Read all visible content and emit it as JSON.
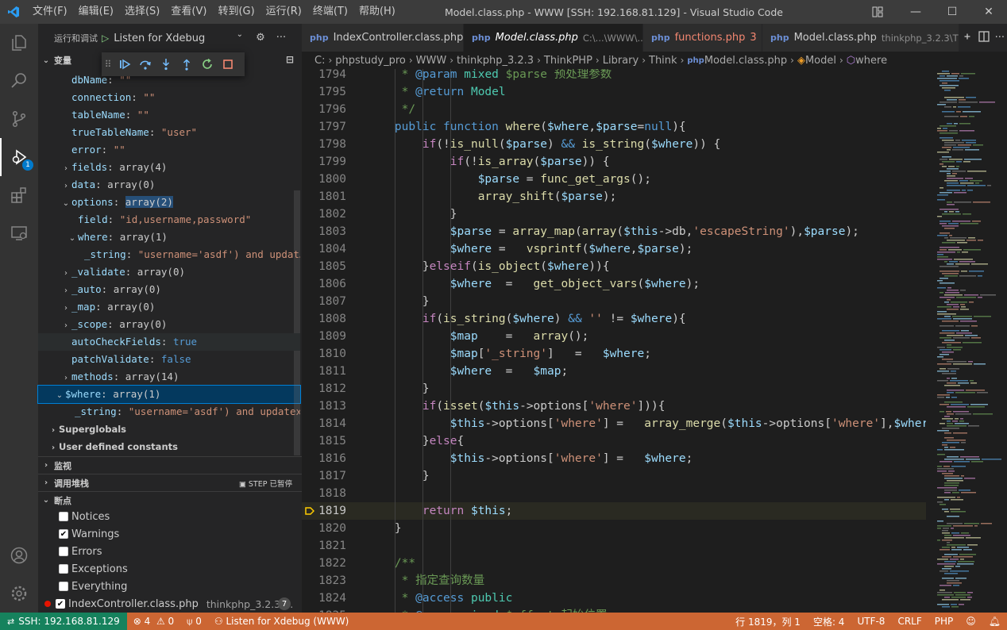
{
  "window": {
    "menu": [
      "文件(F)",
      "编辑(E)",
      "选择(S)",
      "查看(V)",
      "转到(G)",
      "运行(R)",
      "终端(T)",
      "帮助(H)"
    ],
    "title": "Model.class.php - WWW [SSH: 192.168.81.129] - Visual Studio Code"
  },
  "activity": {
    "debug_badge": "1"
  },
  "sidebar": {
    "run_label": "运行和调试",
    "config": "Listen for Xdebug",
    "variables_title": "变量",
    "variables": [
      {
        "indent": 0,
        "twisty": "",
        "key": "dbName",
        "val": "\"\"",
        "vtype": "s"
      },
      {
        "indent": 0,
        "twisty": "",
        "key": "connection",
        "val": "\"\"",
        "vtype": "s"
      },
      {
        "indent": 0,
        "twisty": "",
        "key": "tableName",
        "val": "\"\"",
        "vtype": "s"
      },
      {
        "indent": 0,
        "twisty": "",
        "key": "trueTableName",
        "val": "\"user\"",
        "vtype": "s"
      },
      {
        "indent": 0,
        "twisty": "",
        "key": "error",
        "val": "\"\"",
        "vtype": "s"
      },
      {
        "indent": 0,
        "twisty": "›",
        "key": "fields",
        "val": "array(4)",
        "vtype": "v"
      },
      {
        "indent": 0,
        "twisty": "›",
        "key": "data",
        "val": "array(0)",
        "vtype": "v"
      },
      {
        "indent": 0,
        "twisty": "⌄",
        "key": "options",
        "val": "array(2)",
        "vtype": "v"
      },
      {
        "indent": 1,
        "twisty": "",
        "key": "field",
        "val": "\"id,username,password\"",
        "vtype": "s"
      },
      {
        "indent": 1,
        "twisty": "⌄",
        "key": "where",
        "val": "array(1)",
        "vtype": "v"
      },
      {
        "indent": 2,
        "twisty": "",
        "key": "_string",
        "val": "\"username='asdf') and updat…",
        "vtype": "s"
      },
      {
        "indent": 0,
        "twisty": "›",
        "key": "_validate",
        "val": "array(0)",
        "vtype": "v"
      },
      {
        "indent": 0,
        "twisty": "›",
        "key": "_auto",
        "val": "array(0)",
        "vtype": "v"
      },
      {
        "indent": 0,
        "twisty": "›",
        "key": "_map",
        "val": "array(0)",
        "vtype": "v"
      },
      {
        "indent": 0,
        "twisty": "›",
        "key": "_scope",
        "val": "array(0)",
        "vtype": "v"
      },
      {
        "indent": 0,
        "twisty": "",
        "key": "autoCheckFields",
        "val": "true",
        "vtype": "b"
      },
      {
        "indent": 0,
        "twisty": "",
        "key": "patchValidate",
        "val": "false",
        "vtype": "b"
      },
      {
        "indent": 0,
        "twisty": "›",
        "key": "methods",
        "val": "array(14)",
        "vtype": "v"
      }
    ],
    "where_var": {
      "key": "$where",
      "val": "array(1)"
    },
    "where_child": {
      "key": "_string",
      "val": "\"username='asdf') and updatex…"
    },
    "superglobals": "Superglobals",
    "user_constants": "User defined constants",
    "watch_title": "监视",
    "callstack_title": "调用堆栈",
    "callstack_status": "STEP 已暂停",
    "breakpoints_title": "断点",
    "breakpoints": [
      {
        "label": "Notices",
        "checked": false
      },
      {
        "label": "Warnings",
        "checked": true
      },
      {
        "label": "Errors",
        "checked": false
      },
      {
        "label": "Exceptions",
        "checked": false
      },
      {
        "label": "Everything",
        "checked": false
      }
    ],
    "bp_file": "IndexController.class.php",
    "bp_dir": "thinkphp_3.2.3\\...",
    "bp_line": "7"
  },
  "tabs": [
    {
      "name": "IndexController.class.php",
      "dir": "",
      "active": false,
      "error": false,
      "suffix": ""
    },
    {
      "name": "Model.class.php",
      "dir": "C:\\...\\WWW\\...",
      "active": true,
      "error": false,
      "suffix": "×"
    },
    {
      "name": "functions.php",
      "dir": "",
      "active": false,
      "error": true,
      "suffix": "3"
    },
    {
      "name": "Model.class.php",
      "dir": "thinkphp_3.2.3\\T",
      "active": false,
      "error": false,
      "suffix": ""
    }
  ],
  "breadcrumb": [
    "C:",
    "phpstudy_pro",
    "WWW",
    "thinkphp_3.2.3",
    "ThinkPHP",
    "Library",
    "Think",
    "Model.class.php",
    "Model",
    "where"
  ],
  "code": {
    "current_line": 1819,
    "lines": [
      {
        "n": "1794",
        "html": "<span class='cm'> * <span class='cmk'>@param</span> <span class='typ'>mixed</span> $parse 预处理参数</span>"
      },
      {
        "n": "1795",
        "html": "<span class='cm'> * <span class='cmk'>@return</span> <span class='typ'>Model</span></span>"
      },
      {
        "n": "1796",
        "html": "<span class='cm'> */</span>"
      },
      {
        "n": "1797",
        "html": "<span class='kw'>public</span> <span class='kw'>function</span> <span class='fn'>where</span>(<span class='var'>$where</span>,<span class='var'>$parse</span>=<span class='kw'>null</span>){"
      },
      {
        "n": "1798",
        "html": "    <span class='ctl'>if</span>(!<span class='fn'>is_null</span>(<span class='var'>$parse</span>) <span class='kw'>&amp;&amp;</span> <span class='fn'>is_string</span>(<span class='var'>$where</span>)) {"
      },
      {
        "n": "1799",
        "html": "        <span class='ctl'>if</span>(!<span class='fn'>is_array</span>(<span class='var'>$parse</span>)) {"
      },
      {
        "n": "1800",
        "html": "            <span class='var'>$parse</span> = <span class='fn'>func_get_args</span>();"
      },
      {
        "n": "1801",
        "html": "            <span class='fn'>array_shift</span>(<span class='var'>$parse</span>);"
      },
      {
        "n": "1802",
        "html": "        }"
      },
      {
        "n": "1803",
        "html": "        <span class='var'>$parse</span> = <span class='fn'>array_map</span>(<span class='fn'>array</span>(<span class='var'>$this</span>-&gt;db,<span class='str'>'escapeString'</span>),<span class='var'>$parse</span>);"
      },
      {
        "n": "1804",
        "html": "        <span class='var'>$where</span> =   <span class='fn'>vsprintf</span>(<span class='var'>$where</span>,<span class='var'>$parse</span>);"
      },
      {
        "n": "1805",
        "html": "    }<span class='ctl'>elseif</span>(<span class='fn'>is_object</span>(<span class='var'>$where</span>)){"
      },
      {
        "n": "1806",
        "html": "        <span class='var'>$where</span>  =   <span class='fn'>get_object_vars</span>(<span class='var'>$where</span>);"
      },
      {
        "n": "1807",
        "html": "    }"
      },
      {
        "n": "1808",
        "html": "    <span class='ctl'>if</span>(<span class='fn'>is_string</span>(<span class='var'>$where</span>) <span class='kw'>&amp;&amp;</span> <span class='str'>''</span> != <span class='var'>$where</span>){"
      },
      {
        "n": "1809",
        "html": "        <span class='var'>$map</span>    =   <span class='fn'>array</span>();"
      },
      {
        "n": "1810",
        "html": "        <span class='var'>$map</span>[<span class='str'>'_string'</span>]   =   <span class='var'>$where</span>;"
      },
      {
        "n": "1811",
        "html": "        <span class='var'>$where</span>  =   <span class='var'>$map</span>;"
      },
      {
        "n": "1812",
        "html": "    }"
      },
      {
        "n": "1813",
        "html": "    <span class='ctl'>if</span>(<span class='fn'>isset</span>(<span class='var'>$this</span>-&gt;options[<span class='str'>'where'</span>])){"
      },
      {
        "n": "1814",
        "html": "        <span class='var'>$this</span>-&gt;options[<span class='str'>'where'</span>] =   <span class='fn'>array_merge</span>(<span class='var'>$this</span>-&gt;options[<span class='str'>'where'</span>],<span class='var'>$where</span>);"
      },
      {
        "n": "1815",
        "html": "    }<span class='ctl'>else</span>{"
      },
      {
        "n": "1816",
        "html": "        <span class='var'>$this</span>-&gt;options[<span class='str'>'where'</span>] =   <span class='var'>$where</span>;"
      },
      {
        "n": "1817",
        "html": "    }"
      },
      {
        "n": "1818",
        "html": ""
      },
      {
        "n": "1819",
        "html": "    <span class='ctl'>return</span> <span class='var'>$this</span>;"
      },
      {
        "n": "1820",
        "html": "}"
      },
      {
        "n": "1821",
        "html": ""
      },
      {
        "n": "1822",
        "html": "<span class='cm'>/**</span>"
      },
      {
        "n": "1823",
        "html": "<span class='cm'> * 指定查询数量</span>"
      },
      {
        "n": "1824",
        "html": "<span class='cm'> * <span class='cmk'>@access</span> <span class='typ'>public</span></span>"
      },
      {
        "n": "1825",
        "html": "<span class='cm'> * <span class='cmk'>@param</span> <span class='typ'>mixed</span> $offset 起始位置</span>"
      }
    ]
  },
  "status": {
    "remote": "SSH: 192.168.81.129",
    "errors": "4",
    "warnings": "0",
    "ports": "0",
    "debug_config": "Listen for Xdebug (WWW)",
    "position": "行 1819，列 1",
    "spaces": "空格: 4",
    "encoding": "UTF-8",
    "eol": "CRLF",
    "language": "PHP"
  },
  "colors": {
    "statusbar": "#cc6633",
    "remote": "#16825d",
    "accent": "#007acc"
  }
}
